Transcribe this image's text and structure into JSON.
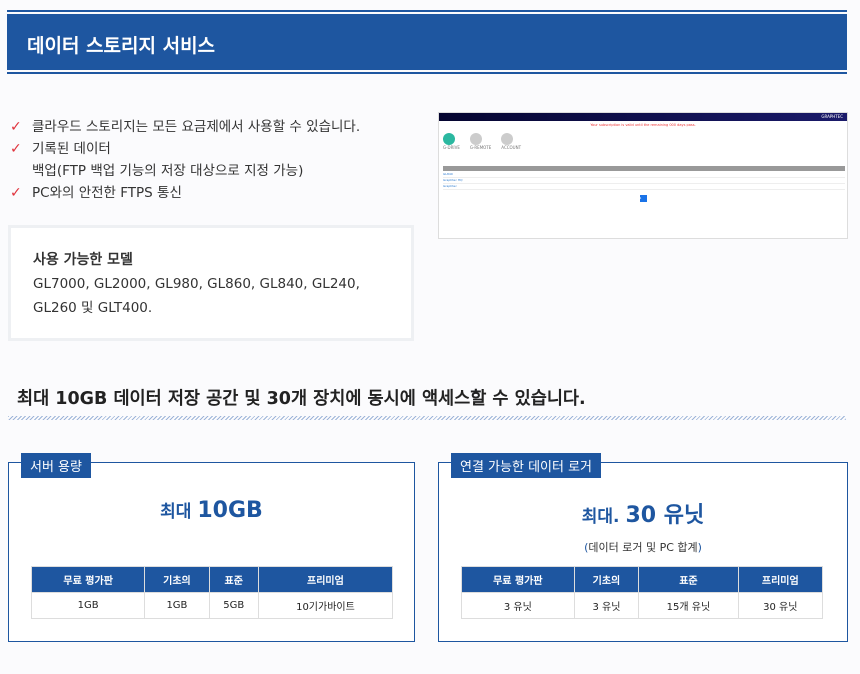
{
  "header": {
    "title": "데이터 스토리지 서비스"
  },
  "features": [
    {
      "text": "클라우드 스토리지는 모든 요금제에서 사용할 수 있습니다."
    },
    {
      "text": "기록된 데이터",
      "sub": "백업(FTP 백업 기능의 저장 대상으로 지정 가능)"
    },
    {
      "text": "PC와의 안전한 FTPS 통신"
    }
  ],
  "check_icon": "check-icon",
  "models": {
    "title": "사용 가능한 모델",
    "list": "GL7000, GL2000, GL980, GL860, GL840, GL240, GL260 및 GLT400."
  },
  "screenshot": {
    "brand": "GRAPHTEC",
    "warning": "Your subscription is valid until the remaining 000 days pass.",
    "tabs": [
      "G-DRIVE",
      "G-REMOTE",
      "ACCOUNT"
    ],
    "rows": [
      "GL840",
      "Graphtec HQ",
      "Graphtec"
    ],
    "page": "1"
  },
  "headline": "최대 10GB 데이터 저장 공간 및 30개 장치에 동시에 액세스할 수 있습니다.",
  "server": {
    "tag": "서버 용량",
    "prefix": "최대 ",
    "value": "10GB",
    "headers": [
      "무료 평가판",
      "기초의",
      "표준",
      "프리미엄"
    ],
    "values": [
      "1GB",
      "1GB",
      "5GB",
      "10기가바이트"
    ]
  },
  "loggers": {
    "tag": "연결 가능한 데이터 로거",
    "prefix": "최대. ",
    "value": "30 유닛",
    "note_open": "(",
    "note": "데이터 로거 및 PC 합계",
    "note_close": ")",
    "headers": [
      "무료 평가판",
      "기초의",
      "표준",
      "프리미엄"
    ],
    "values": [
      "3 유닛",
      "3 유닛",
      "15개 유닛",
      "30 유닛"
    ]
  }
}
